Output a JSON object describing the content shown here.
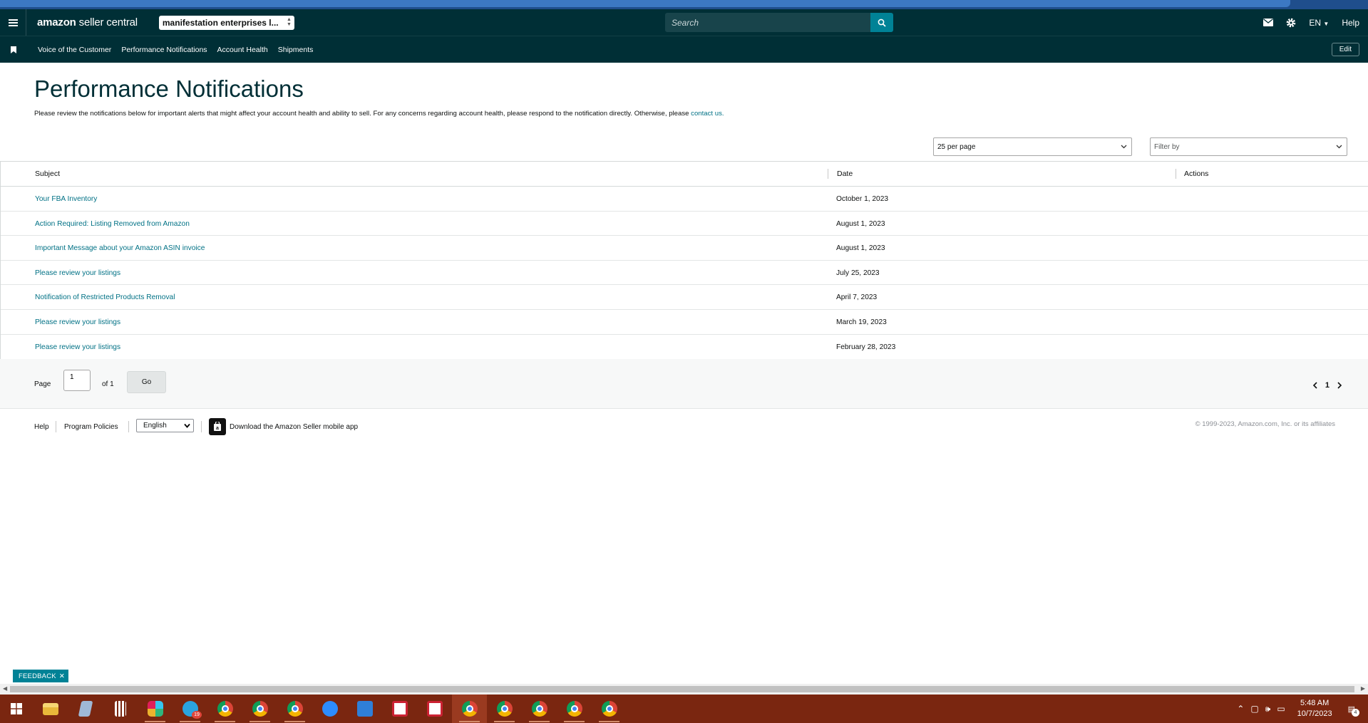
{
  "header": {
    "logo_brand": "amazon",
    "logo_product": "seller central",
    "account": "manifestation enterprises l...",
    "search_placeholder": "Search",
    "language": "EN",
    "help": "Help"
  },
  "nav": {
    "items": [
      "Voice of the Customer",
      "Performance Notifications",
      "Account Health",
      "Shipments"
    ],
    "edit_label": "Edit"
  },
  "page": {
    "title": "Performance Notifications",
    "description": "Please review the notifications below for important alerts that might affect your account health and ability to sell. For any concerns regarding account health, please respond to the notification directly. Otherwise, please ",
    "contact_link": "contact us."
  },
  "controls": {
    "per_page": "25 per page",
    "filter_by": "Filter by"
  },
  "table": {
    "columns": [
      "Subject",
      "Date",
      "Actions"
    ],
    "rows": [
      {
        "subject": "Your FBA Inventory",
        "date": "October 1, 2023"
      },
      {
        "subject": "Action Required: Listing Removed from Amazon",
        "date": "August 1, 2023"
      },
      {
        "subject": "Important Message about your Amazon ASIN invoice",
        "date": "August 1, 2023"
      },
      {
        "subject": "Please review your listings",
        "date": "July 25, 2023"
      },
      {
        "subject": "Notification of Restricted Products Removal",
        "date": "April 7, 2023"
      },
      {
        "subject": "Please review your listings",
        "date": "March 19, 2023"
      },
      {
        "subject": "Please review your listings",
        "date": "February 28, 2023"
      }
    ]
  },
  "pagination": {
    "page_label": "Page",
    "page_value": "1",
    "of_label": "of 1",
    "go_label": "Go",
    "current_page": "1"
  },
  "footer": {
    "help": "Help",
    "policies": "Program Policies",
    "language": "English",
    "app_link": "Download the Amazon Seller mobile app",
    "copyright": "© 1999-2023, Amazon.com, Inc. or its affiliates"
  },
  "feedback_label": "FEEDBACK",
  "taskbar": {
    "time": "5:48 AM",
    "date": "10/7/2023",
    "telegram_badge": "19",
    "notifications_badge": "4"
  },
  "colors": {
    "header_bg": "#002f36",
    "link": "#007185",
    "accent": "#008296",
    "taskbar_bg": "#7a2610"
  }
}
